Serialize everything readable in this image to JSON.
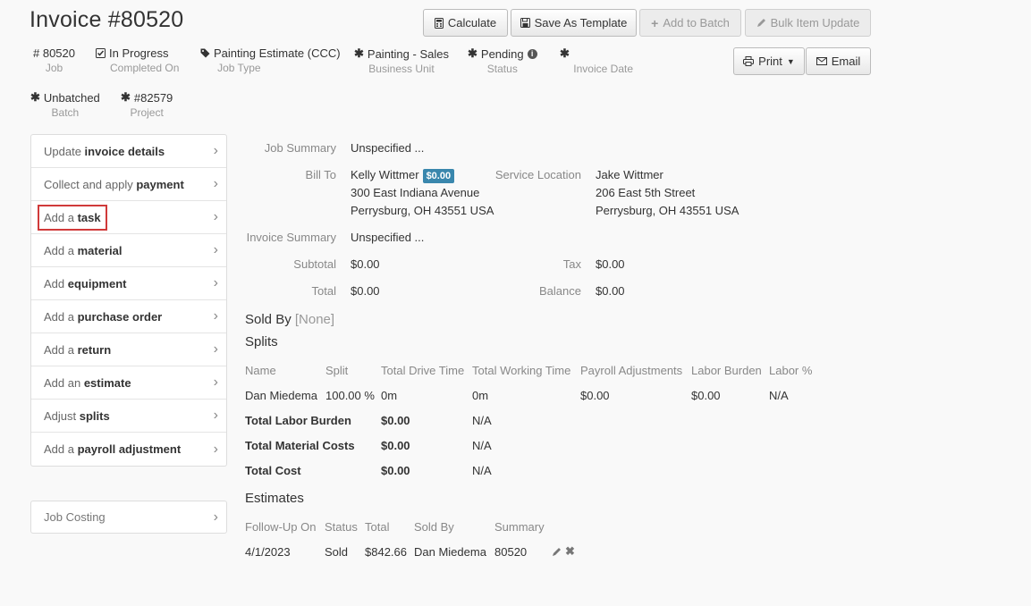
{
  "header": {
    "title": "Invoice #80520"
  },
  "toolbar": {
    "calculate": "Calculate",
    "save_template": "Save As Template",
    "add_batch": "Add to Batch",
    "bulk_update": "Bulk Item Update",
    "print": "Print",
    "email": "Email"
  },
  "meta": {
    "job": {
      "value": "# 80520",
      "label": "Job"
    },
    "completed": {
      "value": "In Progress",
      "label": "Completed On"
    },
    "job_type": {
      "value": "Painting Estimate (CCC)",
      "label": "Job Type"
    },
    "business_unit": {
      "value": "Painting - Sales",
      "label": "Business Unit"
    },
    "status": {
      "value": "Pending",
      "label": "Status"
    },
    "invoice_date": {
      "value": "",
      "label": "Invoice Date"
    },
    "batch": {
      "value": "Unbatched",
      "label": "Batch"
    },
    "project": {
      "value": "#82579",
      "label": "Project"
    }
  },
  "sidebar": {
    "items": [
      {
        "pre": "Update ",
        "bold": "invoice details"
      },
      {
        "pre": "Collect and apply ",
        "bold": "payment"
      },
      {
        "pre": "Add a ",
        "bold": "task"
      },
      {
        "pre": "Add a ",
        "bold": "material"
      },
      {
        "pre": "Add ",
        "bold": "equipment"
      },
      {
        "pre": "Add a ",
        "bold": "purchase order"
      },
      {
        "pre": "Add a ",
        "bold": "return"
      },
      {
        "pre": "Add an ",
        "bold": "estimate"
      },
      {
        "pre": "Adjust ",
        "bold": "splits"
      },
      {
        "pre": "Add a ",
        "bold": "payroll adjustment"
      }
    ],
    "job_costing": "Job Costing"
  },
  "summary": {
    "job_summary_label": "Job Summary",
    "job_summary_value": "Unspecified ...",
    "bill_to_label": "Bill To",
    "bill_to_name": "Kelly Wittmer",
    "bill_to_badge": "$0.00",
    "bill_to_street": "300 East Indiana Avenue",
    "bill_to_city": "Perrysburg, OH 43551 USA",
    "service_location_label": "Service Location",
    "service_name": "Jake Wittmer",
    "service_street": "206 East 5th Street",
    "service_city": "Perrysburg, OH 43551 USA",
    "invoice_summary_label": "Invoice Summary",
    "invoice_summary_value": "Unspecified ...",
    "subtotal_label": "Subtotal",
    "subtotal_value": "$0.00",
    "tax_label": "Tax",
    "tax_value": "$0.00",
    "total_label": "Total",
    "total_value": "$0.00",
    "balance_label": "Balance",
    "balance_value": "$0.00"
  },
  "sold_by": {
    "label": "Sold By",
    "value": "[None]"
  },
  "splits": {
    "title": "Splits",
    "headers": [
      "Name",
      "Split",
      "Total Drive Time",
      "Total Working Time",
      "Payroll Adjustments",
      "Labor Burden",
      "Labor %"
    ],
    "row": [
      "Dan Miedema",
      "100.00 %",
      "0m",
      "0m",
      "$0.00",
      "$0.00",
      "N/A"
    ],
    "totals": [
      {
        "label": "Total Labor Burden",
        "a": "$0.00",
        "b": "N/A"
      },
      {
        "label": "Total Material Costs",
        "a": "$0.00",
        "b": "N/A"
      },
      {
        "label": "Total Cost",
        "a": "$0.00",
        "b": "N/A"
      }
    ]
  },
  "estimates": {
    "title": "Estimates",
    "headers": [
      "Follow-Up On",
      "Status",
      "Total",
      "Sold By",
      "Summary"
    ],
    "row": [
      "4/1/2023",
      "Sold",
      "$842.66",
      "Dan Miedema",
      "80520"
    ]
  }
}
